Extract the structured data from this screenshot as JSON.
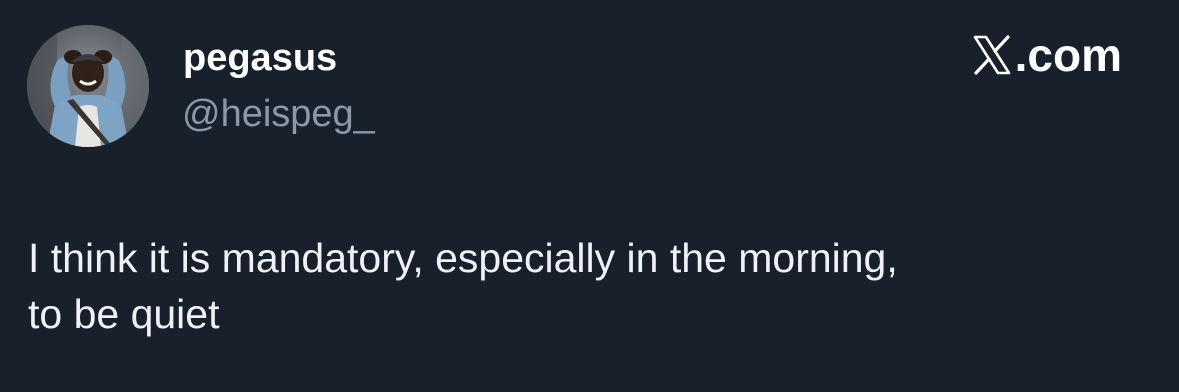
{
  "tweet": {
    "display_name": "pegasus",
    "handle": "@heispeg_",
    "text_line_1": "I think it is mandatory, especially in the morning,",
    "text_line_2": "to be quiet"
  },
  "brand": {
    "label": ".com",
    "icon": "x-logo-icon"
  },
  "avatar": {
    "icon": "profile-photo"
  },
  "colors": {
    "background": "#18202b",
    "name": "#ffffff",
    "handle": "#8b98a5",
    "text": "#eef1f5"
  }
}
